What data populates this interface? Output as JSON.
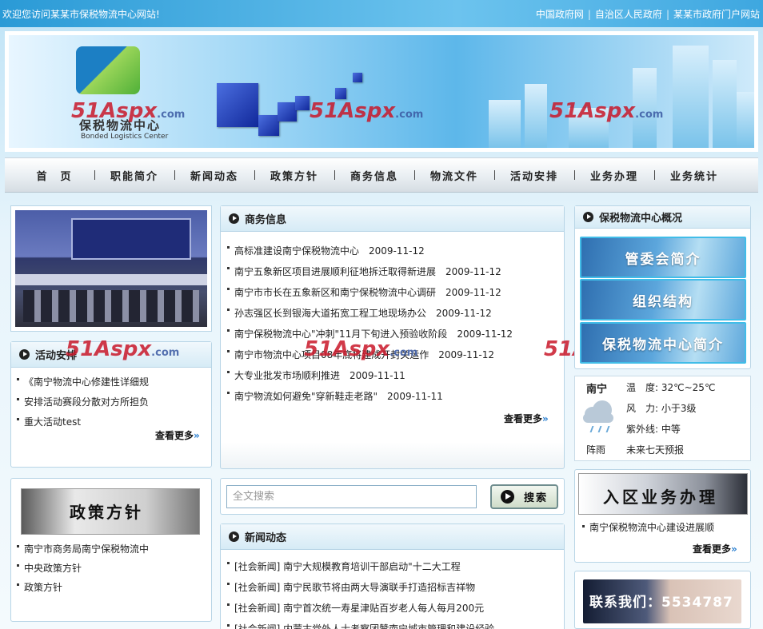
{
  "topbar": {
    "welcome": "欢迎您访问某某市保税物流中心网站!",
    "links": [
      "中国政府网",
      "自治区人民政府",
      "某某市政府门户网站"
    ]
  },
  "banner": {
    "logo_cn": "保税物流中心",
    "logo_en": "Bonded Logistics Center",
    "watermark": "51Aspx",
    "watermark_suffix": ".com"
  },
  "nav": [
    "首　页",
    "职能简介",
    "新闻动态",
    "政策方针",
    "商务信息",
    "物流文件",
    "活动安排",
    "业务办理",
    "业务统计"
  ],
  "activity": {
    "title": "活动安排",
    "items": [
      "《南宁物流中心修建性详细规",
      "安排活动赛段分散对方所担负",
      "重大活动test"
    ],
    "more": "查看更多"
  },
  "policy": {
    "banner_text": "政策方针",
    "items": [
      "南宁市商务局南宁保税物流中",
      "中央政策方针",
      "政策方针"
    ]
  },
  "business": {
    "title": "商务信息",
    "items": [
      {
        "title": "高标准建设南宁保税物流中心",
        "date": "2009-11-12"
      },
      {
        "title": "南宁五象新区项目进展顺利征地拆迁取得新进展",
        "date": "2009-11-12"
      },
      {
        "title": "南宁市市长在五象新区和南宁保税物流中心调研",
        "date": "2009-11-12"
      },
      {
        "title": "孙志强区长到银海大道拓宽工程工地现场办公",
        "date": "2009-11-12"
      },
      {
        "title": "南宁保税物流中心\"冲刺\"11月下旬进入预验收阶段",
        "date": "2009-11-12"
      },
      {
        "title": "南宁市物流中心项目08年底将建成开封关运作",
        "date": "2009-11-12"
      },
      {
        "title": "大专业批发市场顺利推进",
        "date": "2009-11-11"
      },
      {
        "title": "南宁物流如何避免\"穿新鞋走老路\"",
        "date": "2009-11-11"
      }
    ],
    "more": "查看更多"
  },
  "search": {
    "placeholder": "全文搜索",
    "button": "搜索"
  },
  "news": {
    "title": "新闻动态",
    "items": [
      "[社会新闻] 南宁大规模教育培训干部启动\"十二大工程",
      "[社会新闻] 南宁民歌节将由两大导演联手打造招标吉祥物",
      "[社会新闻] 南宁首次统一寿星津贴百岁老人每人每月200元",
      "[社会新闻] 内蒙古党外人士考察团赞南宁城市管理和建设经验"
    ]
  },
  "overview": {
    "title": "保税物流中心概况",
    "buttons": [
      "管委会简介",
      "组织结构",
      "保税物流中心简介"
    ]
  },
  "weather": {
    "city": "南宁",
    "temp_label": "温　度:",
    "temp": "32℃~25℃",
    "wind_label": "风　力:",
    "wind": "小于3级",
    "uv_label": "紫外线:",
    "uv": "中等",
    "condition": "阵雨",
    "forecast": "未来七天预报"
  },
  "ruqu": {
    "banner_text": "入区业务办理",
    "items": [
      "南宁保税物流中心建设进展顺"
    ],
    "more": "查看更多"
  },
  "contact": {
    "text": "联系我们：5534787"
  },
  "colors": {
    "topbar": "#2a9ad6",
    "box_border": "#b8d5e6",
    "watermark": "#c9182a",
    "more_arrows": "#2a7fd0"
  }
}
